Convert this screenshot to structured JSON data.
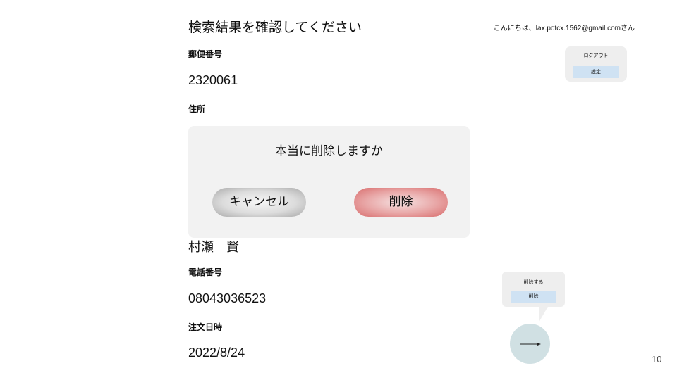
{
  "page": {
    "title": "検索結果を確認してください",
    "number": "10"
  },
  "header": {
    "greeting": "こんにちは、lax.potcx.1562@gmail.comさん"
  },
  "account_menu": {
    "logout_label": "ログアウト",
    "settings_label": "設定"
  },
  "fields": {
    "postal_code_label": "郵便番号",
    "postal_code_value": "2320061",
    "address_label": "住所",
    "name_value": "村瀬　賢",
    "phone_label": "電話番号",
    "phone_value": "08043036523",
    "order_date_label": "注文日時",
    "order_date_value": "2022/8/24"
  },
  "dialog": {
    "title": "本当に削除しますか",
    "cancel_label": "キャンセル",
    "delete_label": "削除"
  },
  "tooltip": {
    "label": "削除する",
    "button_label": "削除"
  },
  "colors": {
    "menu_button_bg": "#cfe2f3",
    "panel_bg": "#eeeeee",
    "next_circle": "#d0e0e3",
    "delete_button": "#e8a5a5",
    "cancel_button": "#dcdcdc"
  },
  "icons": {
    "next": "arrow-right-icon"
  }
}
